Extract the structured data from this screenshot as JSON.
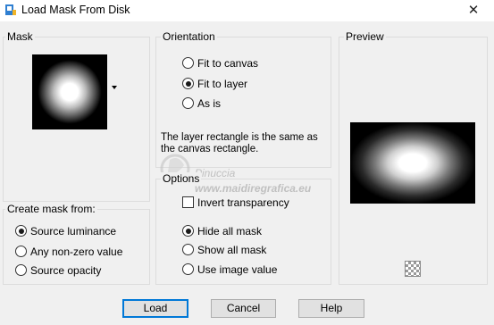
{
  "window": {
    "title": "Load Mask From Disk",
    "close_glyph": "✕"
  },
  "mask_group": {
    "label": "Mask",
    "thumbnail_icon": "mask-thumbnail"
  },
  "create_from_group": {
    "label": "Create mask from:",
    "options": [
      {
        "label": "Source luminance",
        "selected": true
      },
      {
        "label": "Any non-zero value",
        "selected": false
      },
      {
        "label": "Source opacity",
        "selected": false
      }
    ]
  },
  "orientation_group": {
    "label": "Orientation",
    "options": [
      {
        "label": "Fit to canvas",
        "selected": false
      },
      {
        "label": "Fit to layer",
        "selected": true
      },
      {
        "label": "As is",
        "selected": false
      }
    ],
    "info": "The layer rectangle is the same as the canvas rectangle."
  },
  "options_group": {
    "label": "Options",
    "invert_transparency": {
      "label": "Invert transparency",
      "checked": false
    },
    "options": [
      {
        "label": "Hide all mask",
        "selected": true
      },
      {
        "label": "Show all mask",
        "selected": false
      },
      {
        "label": "Use image value",
        "selected": false
      }
    ]
  },
  "preview_group": {
    "label": "Preview"
  },
  "watermark": {
    "name": "Pinuccia",
    "url": "www.maidiregrafica.eu"
  },
  "buttons": {
    "load": "Load",
    "cancel": "Cancel",
    "help": "Help"
  }
}
